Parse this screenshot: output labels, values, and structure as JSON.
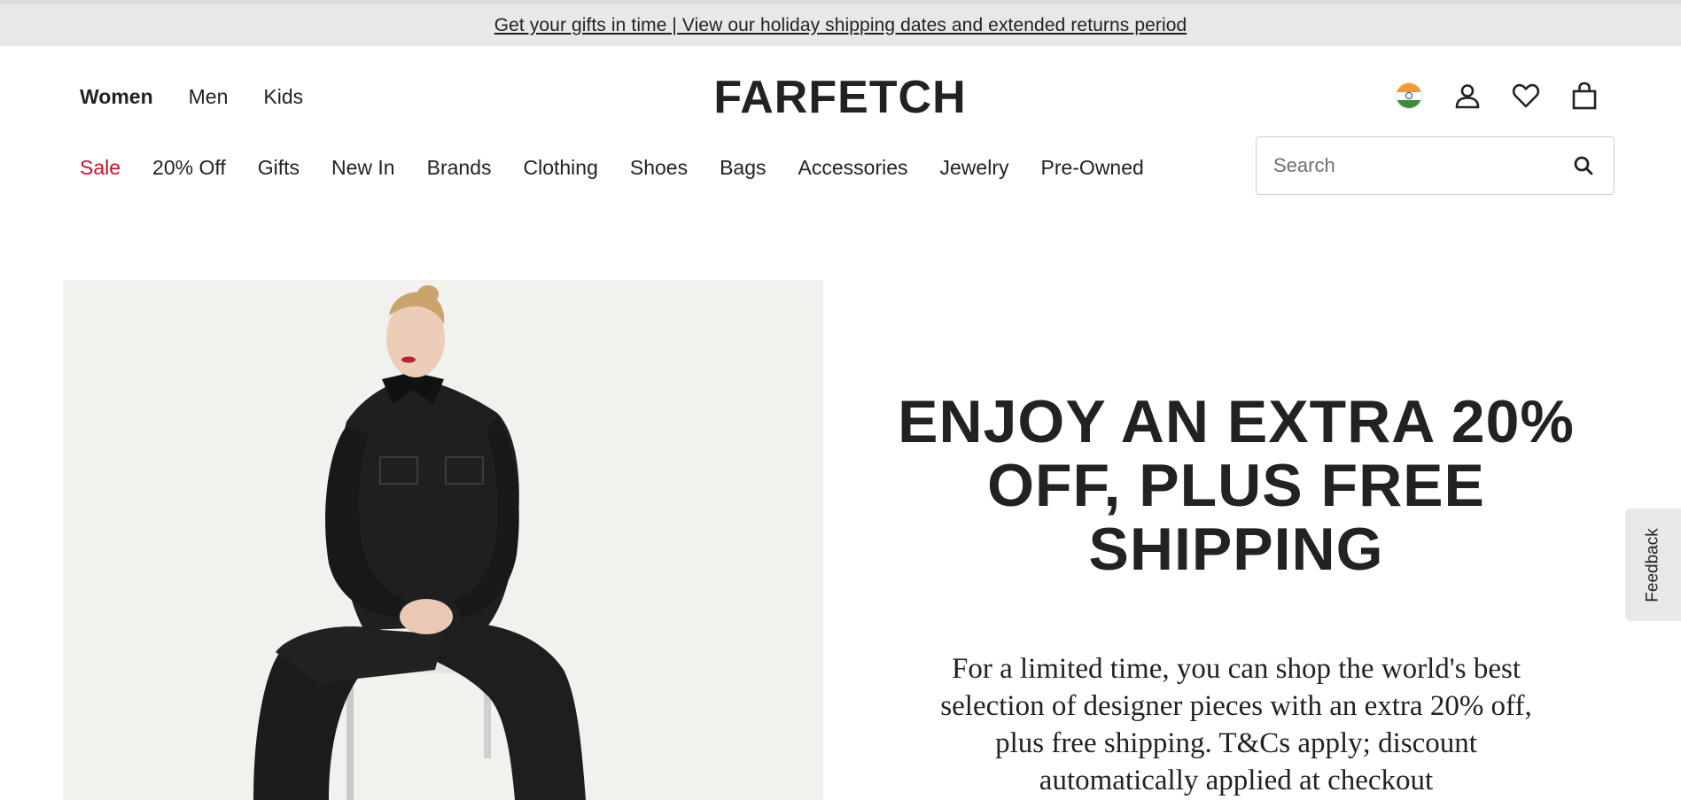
{
  "announcement": {
    "text": "Get your gifts in time | View our holiday shipping dates and extended returns period"
  },
  "header": {
    "departments": [
      {
        "label": "Women",
        "active": true
      },
      {
        "label": "Men",
        "active": false
      },
      {
        "label": "Kids",
        "active": false
      }
    ],
    "logo": "FARFETCH",
    "icons": [
      "india-flag-icon",
      "account-icon",
      "wishlist-heart-icon",
      "shopping-bag-icon"
    ]
  },
  "nav": {
    "categories": [
      "Sale",
      "20% Off",
      "Gifts",
      "New In",
      "Brands",
      "Clothing",
      "Shoes",
      "Bags",
      "Accessories",
      "Jewelry",
      "Pre-Owned"
    ],
    "sale_color": "#c8102e"
  },
  "search": {
    "placeholder": "Search",
    "value": ""
  },
  "hero": {
    "headline": "ENJOY AN EXTRA 20% OFF, PLUS FREE SHIPPING",
    "body": "For a limited time, you can shop the world's best selection of designer pieces with an extra 20% off, plus free shipping. T&Cs apply; discount automatically applied at checkout"
  },
  "feedback": {
    "label": "Feedback"
  }
}
